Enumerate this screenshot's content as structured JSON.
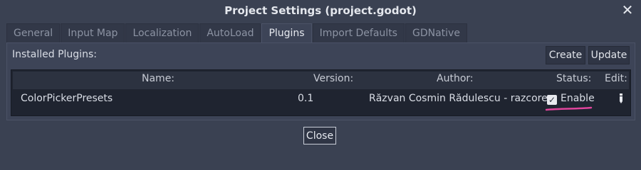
{
  "window": {
    "title": "Project Settings (project.godot)",
    "close_glyph": "✕"
  },
  "tabs": [
    {
      "label": "General",
      "active": false
    },
    {
      "label": "Input Map",
      "active": false
    },
    {
      "label": "Localization",
      "active": false
    },
    {
      "label": "AutoLoad",
      "active": false
    },
    {
      "label": "Plugins",
      "active": true
    },
    {
      "label": "Import Defaults",
      "active": false
    },
    {
      "label": "GDNative",
      "active": false
    }
  ],
  "plugins": {
    "installed_label": "Installed Plugins:",
    "create_label": "Create",
    "update_label": "Update",
    "columns": {
      "name": "Name:",
      "version": "Version:",
      "author": "Author:",
      "status": "Status:",
      "edit": "Edit:"
    },
    "rows": [
      {
        "name": "ColorPickerPresets",
        "version": "0.1",
        "author": "Răzvan Cosmin Rădulescu - razcore",
        "status": "Enable",
        "enabled": true,
        "edit_icon": "pencil-icon"
      }
    ]
  },
  "footer": {
    "close_label": "Close"
  },
  "colors": {
    "background": "#3a4152",
    "panel": "#3d4457",
    "tree": "#1f2430",
    "highlight": "#e0449c"
  }
}
